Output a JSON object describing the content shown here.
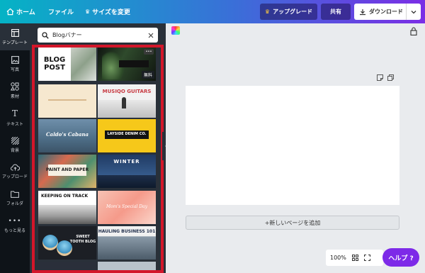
{
  "colors": {
    "accent": "#7d2ae8",
    "highlight": "#d3162a",
    "rail": "#0e1318",
    "panel": "#293039"
  },
  "topbar": {
    "home": "ホーム",
    "file": "ファイル",
    "resize": "サイズを変更",
    "upgrade": "アップグレード",
    "share": "共有",
    "download": "ダウンロード"
  },
  "rail": [
    {
      "label": "テンプレート",
      "icon": "template-icon"
    },
    {
      "label": "写真",
      "icon": "photo-icon"
    },
    {
      "label": "素材",
      "icon": "elements-icon"
    },
    {
      "label": "テキスト",
      "icon": "text-icon"
    },
    {
      "label": "背景",
      "icon": "background-icon"
    },
    {
      "label": "アップロード",
      "icon": "upload-icon"
    },
    {
      "label": "フォルダ",
      "icon": "folder-icon"
    },
    {
      "label": "もっと見る",
      "icon": "more-icon"
    }
  ],
  "search": {
    "value": "Blogバナー"
  },
  "templates": {
    "t1_line1": "BLOG",
    "t1_line2": "POST",
    "t2_badge": "無料",
    "t2_more": "•••",
    "t4_title": "MUSIQO GUITARS",
    "t5_title": "Caldo's Cabana",
    "t6_title": "LAYSIDE DENIM CO.",
    "t7_title": "PAINT AND PAPER",
    "t8_title": "WINTER",
    "t9_title": "KEEPING ON TRACK",
    "t10_title": "Mom's Special Day",
    "t11_line1": "SWEET",
    "t11_line2": "TOOTH BLOG",
    "t12_title": "HAULING BUSINESS 101"
  },
  "editor": {
    "add_page": "+新しいページを追加",
    "zoom": "100%",
    "help": "ヘルプ ?"
  }
}
